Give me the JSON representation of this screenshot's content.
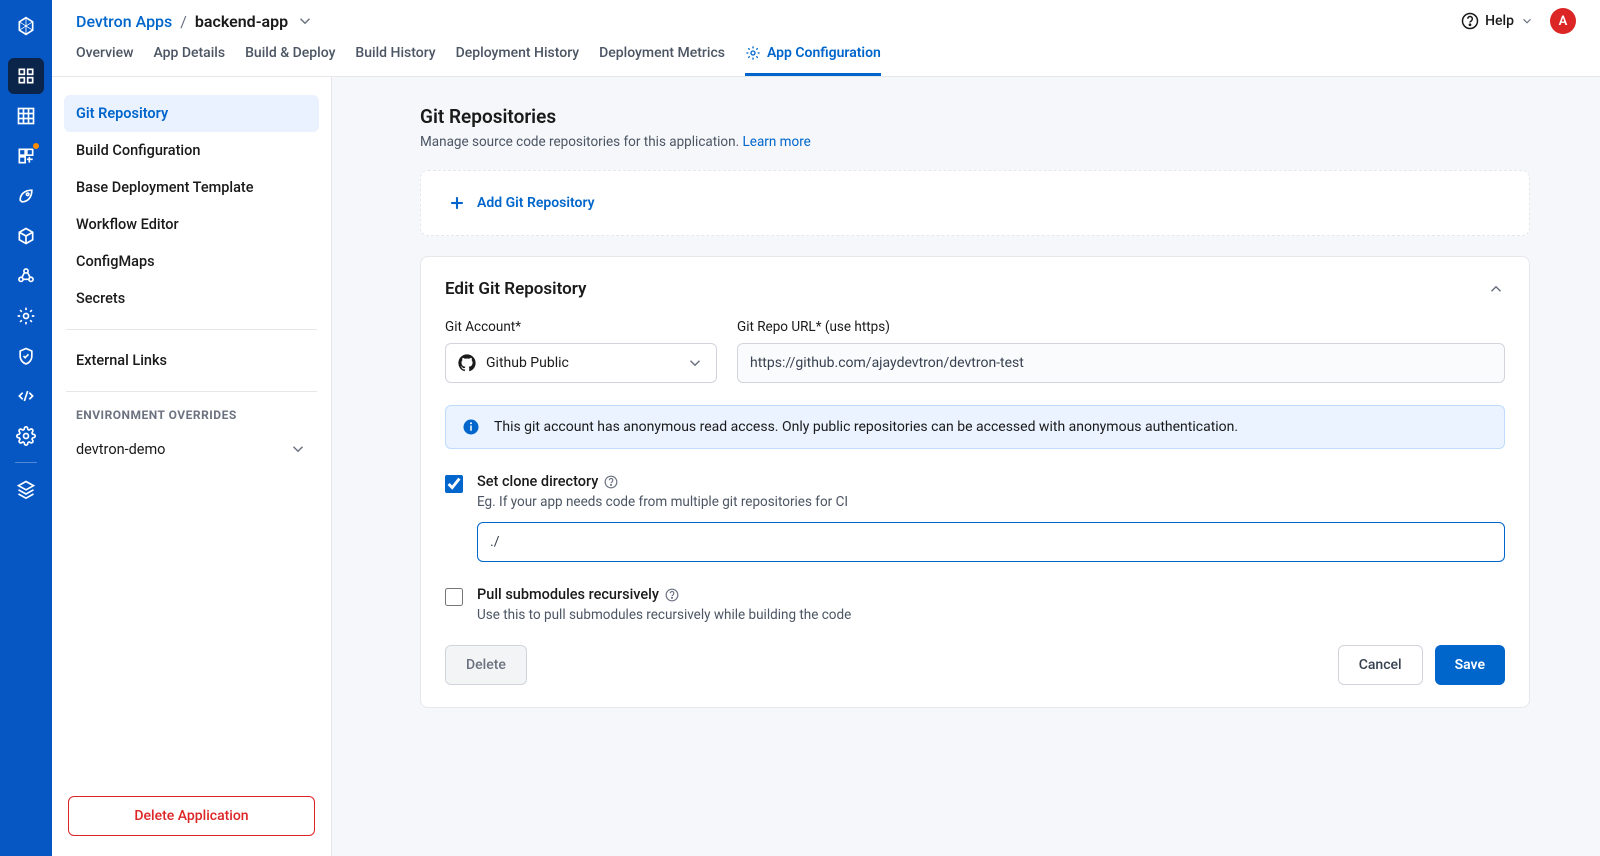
{
  "breadcrumb": {
    "root": "Devtron Apps",
    "sep": "/",
    "current": "backend-app"
  },
  "header": {
    "help": "Help",
    "avatar_initial": "A"
  },
  "tabs": [
    {
      "label": "Overview",
      "active": false,
      "icon": null
    },
    {
      "label": "App Details",
      "active": false,
      "icon": null
    },
    {
      "label": "Build & Deploy",
      "active": false,
      "icon": null
    },
    {
      "label": "Build History",
      "active": false,
      "icon": null
    },
    {
      "label": "Deployment History",
      "active": false,
      "icon": null
    },
    {
      "label": "Deployment Metrics",
      "active": false,
      "icon": null
    },
    {
      "label": "App Configuration",
      "active": true,
      "icon": "gear"
    }
  ],
  "sidebar": {
    "items": [
      {
        "label": "Git Repository",
        "active": true
      },
      {
        "label": "Build Configuration",
        "active": false
      },
      {
        "label": "Base Deployment Template",
        "active": false
      },
      {
        "label": "Workflow Editor",
        "active": false
      },
      {
        "label": "ConfigMaps",
        "active": false
      },
      {
        "label": "Secrets",
        "active": false
      }
    ],
    "external_links": "External Links",
    "env_heading": "ENVIRONMENT OVERRIDES",
    "env_item": "devtron-demo",
    "delete_app": "Delete Application"
  },
  "page": {
    "title": "Git Repositories",
    "subtitle": "Manage source code repositories for this application.",
    "learn_more": "Learn more",
    "add_repo": "Add Git Repository",
    "edit_title": "Edit Git Repository",
    "git_account_label": "Git Account*",
    "git_account_value": "Github Public",
    "repo_url_label": "Git Repo URL* (use https)",
    "repo_url_value": "https://github.com/ajaydevtron/devtron-test",
    "info_banner": "This git account has anonymous read access. Only public repositories can be accessed with anonymous authentication.",
    "clone_dir": {
      "label": "Set clone directory",
      "desc": "Eg. If your app needs code from multiple git repositories for CI",
      "value": "./"
    },
    "submodules": {
      "label": "Pull submodules recursively",
      "desc": "Use this to pull submodules recursively while building the code"
    },
    "buttons": {
      "delete": "Delete",
      "cancel": "Cancel",
      "save": "Save"
    }
  }
}
